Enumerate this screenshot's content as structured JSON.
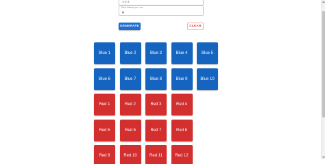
{
  "form": {
    "field1": {
      "label": "",
      "value": "1-2-3"
    },
    "field2": {
      "label": "Red tokens per row",
      "value": "4"
    },
    "generate_label": "GENERATE",
    "clear_label": "CLEAR"
  },
  "blue_tiles": [
    "Blue 1",
    "Blue 2",
    "Blue 3",
    "Blue 4",
    "Blue 5",
    "Blue 6",
    "Blue 7",
    "Blue 8",
    "Blue 9",
    "Blue 10"
  ],
  "red_tiles": [
    "Red 1",
    "Red 2",
    "Red 3",
    "Red 4",
    "Red 5",
    "Red 6",
    "Red 7",
    "Red 8",
    "Red 9",
    "Red 10",
    "Red 11",
    "Red 12"
  ],
  "colors": {
    "blue": "#1565c0",
    "red": "#d32f2f",
    "generate_bg": "#1d6fd1",
    "clear_text": "#d64040"
  }
}
